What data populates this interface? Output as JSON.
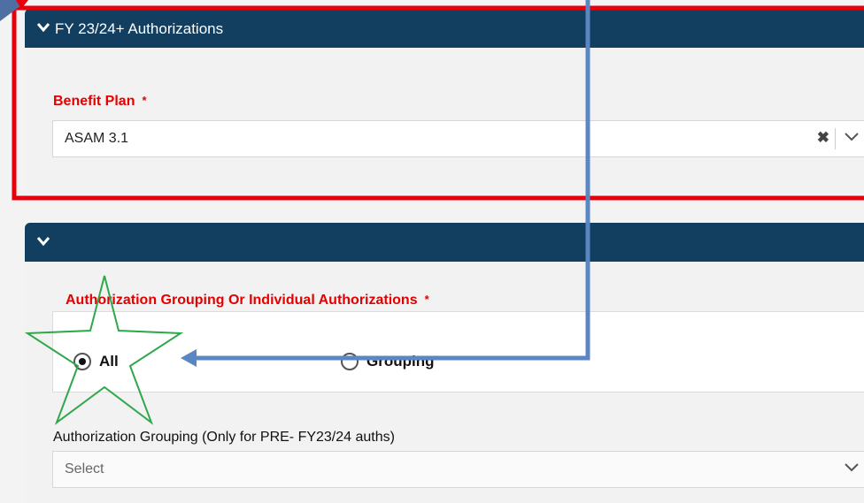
{
  "section1": {
    "title": "FY 23/24+ Authorizations",
    "benefit_plan": {
      "label": "Benefit Plan",
      "required_mark": "*",
      "value": "ASAM 3.1",
      "clear_glyph": "✖",
      "dropdown_icon": "chevron-down-icon"
    }
  },
  "section2": {
    "title": "",
    "auth_grouping_choice": {
      "label": "Authorization Grouping Or Individual Authorizations",
      "required_mark": "*",
      "options": [
        {
          "label": "All",
          "checked": true
        },
        {
          "label": "Grouping",
          "checked": false
        }
      ]
    },
    "auth_grouping_select": {
      "label": "Authorization Grouping (Only for PRE- FY23/24 auths)",
      "placeholder": "Select"
    }
  },
  "annotations": {
    "highlight_color": "#e8000b",
    "arrow_color": "#5b86c4",
    "star_color": "#2ea84a"
  }
}
